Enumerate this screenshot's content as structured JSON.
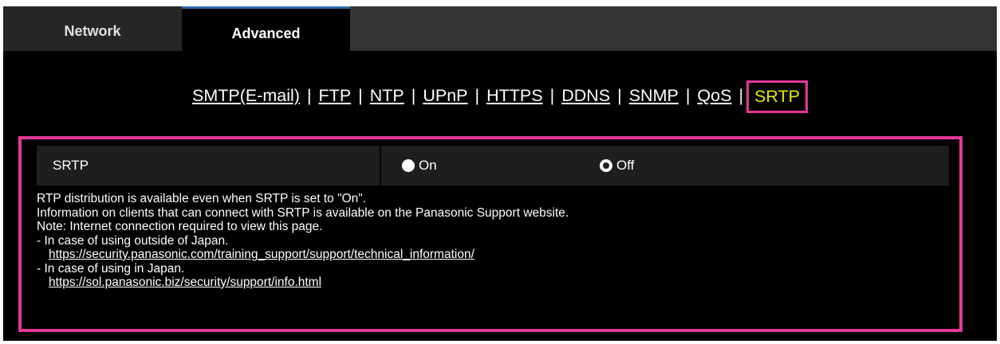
{
  "tabs": [
    {
      "label": "Network",
      "active": false
    },
    {
      "label": "Advanced",
      "active": true
    }
  ],
  "subnav": {
    "links": [
      "SMTP(E-mail)",
      "FTP",
      "NTP",
      "UPnP",
      "HTTPS",
      "DDNS",
      "SNMP",
      "QoS"
    ],
    "separator": "|",
    "active": "SRTP"
  },
  "srtp": {
    "label": "SRTP",
    "options": [
      {
        "label": "On",
        "selected": false
      },
      {
        "label": "Off",
        "selected": true
      }
    ]
  },
  "notes": {
    "line1": "RTP distribution is available even when SRTP is set to \"On\".",
    "line2": "Information on clients that can connect with SRTP is available on the Panasonic Support website.",
    "line3": "Note: Internet connection required to view this page.",
    "line4": "- In case of using outside of Japan.",
    "link1": "https://security.panasonic.com/training_support/support/technical_information/",
    "line5": "- In case of using in Japan.",
    "link2": "https://sol.panasonic.biz/security/support/info.html"
  },
  "colors": {
    "highlight_border": "#e4379a",
    "active_link": "#e8e800",
    "active_tab_accent": "#2b6aa8"
  }
}
